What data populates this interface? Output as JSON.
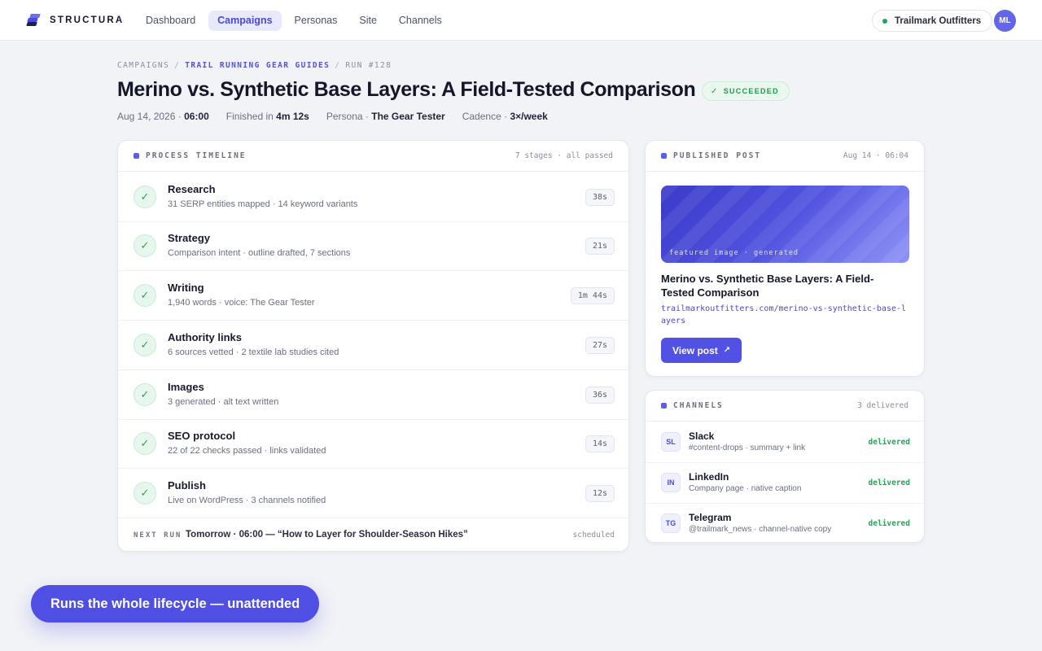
{
  "app": {
    "name": "STRUCTURA"
  },
  "nav": {
    "items": [
      {
        "label": "Dashboard",
        "active": false
      },
      {
        "label": "Campaigns",
        "active": true
      },
      {
        "label": "Personas",
        "active": false
      },
      {
        "label": "Site",
        "active": false
      },
      {
        "label": "Channels",
        "active": false
      }
    ],
    "org": "Trailmark Outfitters",
    "avatar_initials": "ML"
  },
  "breadcrumb": [
    "CAMPAIGNS",
    "TRAIL RUNNING GEAR GUIDES",
    "RUN #128"
  ],
  "page": {
    "title": "Merino vs. Synthetic Base Layers: A Field-Tested Comparison",
    "status": "SUCCEEDED",
    "status_color": "#1f9b52",
    "meta": {
      "date": "Aug 14, 2026 ·",
      "time": "06:00",
      "finished_label": "Finished in",
      "finished_value": "4m 12s",
      "persona_label": "Persona ·",
      "persona_value": "The Gear Tester",
      "cadence_label": "Cadence ·",
      "cadence_value": "3×/week"
    }
  },
  "timeline": {
    "title": "PROCESS TIMELINE",
    "summary": "7 stages · all passed",
    "stages": [
      {
        "name": "Research",
        "desc": "31 SERP entities mapped · 14 keyword variants",
        "duration": "38s"
      },
      {
        "name": "Strategy",
        "desc": "Comparison intent · outline drafted, 7 sections",
        "duration": "21s"
      },
      {
        "name": "Writing",
        "desc": "1,940 words · voice: The Gear Tester",
        "duration": "1m 44s"
      },
      {
        "name": "Authority links",
        "desc": "6 sources vetted · 2 textile lab studies cited",
        "duration": "27s"
      },
      {
        "name": "Images",
        "desc": "3 generated · alt text written",
        "duration": "36s"
      },
      {
        "name": "SEO protocol",
        "desc": "22 of 22 checks passed · links validated",
        "duration": "14s"
      },
      {
        "name": "Publish",
        "desc": "Live on WordPress · 3 channels notified",
        "duration": "12s"
      }
    ],
    "next_run": {
      "label": "NEXT RUN",
      "value": "Tomorrow · 06:00 — “How to Layer for Shoulder-Season Hikes”",
      "status": "scheduled"
    }
  },
  "post": {
    "title": "PUBLISHED POST",
    "timestamp": "Aug 14 · 06:04",
    "image_caption": "featured image · generated",
    "post_title": "Merino vs. Synthetic Base Layers: A Field-Tested Comparison",
    "url": "trailmarkoutfitters.com/merino-vs-synthetic-base-layers",
    "button": "View post",
    "accent": "#5152e5"
  },
  "channels": {
    "title": "CHANNELS",
    "summary": "3 delivered",
    "items": [
      {
        "abbr": "SL",
        "name": "Slack",
        "desc": "#content-drops · summary + link",
        "status": "delivered"
      },
      {
        "abbr": "IN",
        "name": "LinkedIn",
        "desc": "Company page · native caption",
        "status": "delivered"
      },
      {
        "abbr": "TG",
        "name": "Telegram",
        "desc": "@trailmark_news · channel-native copy",
        "status": "delivered"
      }
    ]
  },
  "cta": "Runs the whole lifecycle — unattended"
}
